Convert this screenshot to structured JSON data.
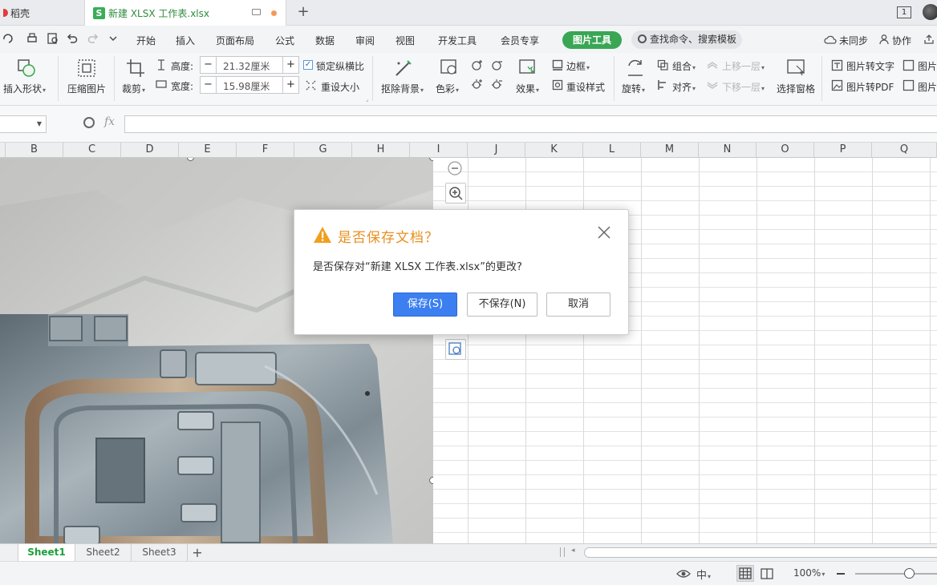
{
  "titlebar": {
    "home_tab": "稻壳",
    "file_tab": "新建 XLSX 工作表.xlsx",
    "file_logo": "S",
    "window_count": "1",
    "new_tab_symbol": "+"
  },
  "menubar": {
    "items": [
      "开始",
      "插入",
      "页面布局",
      "公式",
      "数据",
      "审阅",
      "视图",
      "开发工具",
      "会员专享"
    ],
    "active_tab": "图片工具",
    "search_placeholder": "查找命令、搜索模板",
    "unsynced": "未同步",
    "collaborate": "协作"
  },
  "ribbon": {
    "insert_shape": "插入形状",
    "compress": "压缩图片",
    "crop": "裁剪",
    "height_label": "高度:",
    "height_value": "21.32厘米",
    "width_label": "宽度:",
    "width_value": "15.98厘米",
    "lock_ratio": "锁定纵横比",
    "reset_size": "重设大小",
    "remove_bg": "抠除背景",
    "color": "色彩",
    "effects": "效果",
    "border": "边框",
    "reset_style": "重设样式",
    "rotate": "旋转",
    "group": "组合",
    "align": "对齐",
    "bring_forward": "上移一层",
    "send_backward": "下移一层",
    "select_pane": "选择窗格",
    "pic_to_text": "图片转文字",
    "pic_to_pdf": "图片转PDF",
    "pic_more_1": "图片",
    "pic_more_2": "图片"
  },
  "formula": {
    "fx": "fx",
    "namebox_value": ""
  },
  "columns": [
    "B",
    "C",
    "D",
    "E",
    "F",
    "G",
    "H",
    "I",
    "J",
    "K",
    "L",
    "M",
    "N",
    "O",
    "P",
    "Q"
  ],
  "sheets": [
    "Sheet1",
    "Sheet2",
    "Sheet3"
  ],
  "add_sheet": "+",
  "status": {
    "zoom": "100%"
  },
  "dialog": {
    "title": "是否保存文档？",
    "message": "是否保存对“新建 XLSX 工作表.xlsx”的更改?",
    "save": "保存(S)",
    "dont_save": "不保存(N)",
    "cancel": "取消"
  },
  "colors": {
    "accent_green": "#3aa655",
    "dialog_title": "#e8901f",
    "primary_button": "#3b7ff0"
  }
}
